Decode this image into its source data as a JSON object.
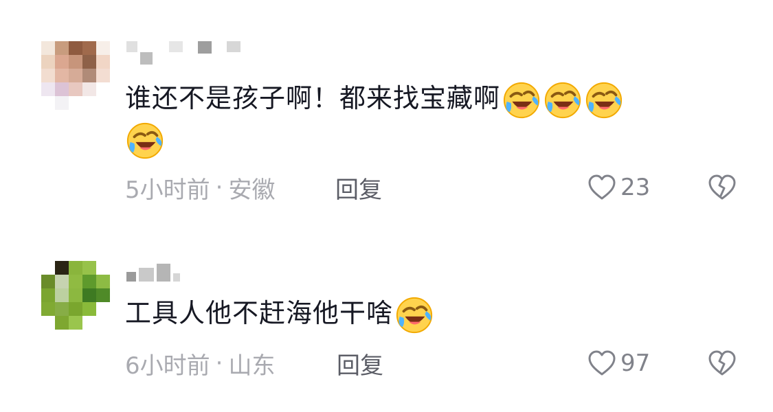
{
  "comments": [
    {
      "text": "谁还不是孩子啊！都来找宝藏啊",
      "emoji_count": 4,
      "time": "5小时前",
      "separator": "·",
      "location": "安徽",
      "reply_label": "回复",
      "like_count": "23",
      "emoji_icon": "laughing-crying-emoji-icon"
    },
    {
      "text": "工具人他不赶海他干啥",
      "emoji_count": 1,
      "time": "6小时前",
      "separator": "·",
      "location": "山东",
      "reply_label": "回复",
      "like_count": "97",
      "emoji_icon": "laughing-crying-emoji-icon"
    }
  ],
  "colors": {
    "text": "#161823",
    "meta": "#a9aab0",
    "reply": "#5b5d66",
    "icon": "#80828a"
  }
}
